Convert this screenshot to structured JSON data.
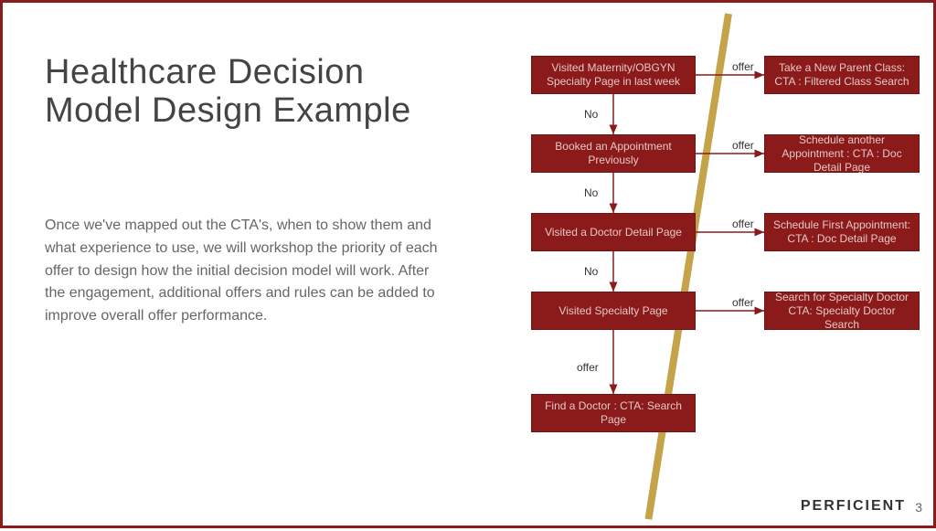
{
  "title_line1": "Healthcare Decision",
  "title_line2": "Model Design Example",
  "body_text": "Once we've mapped out the CTA's, when to show them and what experience to use, we will workshop the priority of each offer to design how the initial decision model will work. After the engagement, additional offers and rules can be added to improve overall offer performance.",
  "brand": "PERFICIENT",
  "page_number": "3",
  "colors": {
    "node_fill": "#8b1a1a",
    "accent": "#c4a349"
  },
  "decision_steps": [
    {
      "label": "Visited Maternity/OBGYN Specialty Page in last week",
      "offer_label": "Take a New Parent Class: CTA : Filtered Class Search"
    },
    {
      "label": "Booked an Appointment Previously",
      "offer_label": "Schedule another Appointment : CTA : Doc Detail Page"
    },
    {
      "label": "Visited a Doctor Detail Page",
      "offer_label": "Schedule First Appointment: CTA : Doc Detail Page"
    },
    {
      "label": "Visited Specialty Page",
      "offer_label": "Search for Specialty Doctor CTA: Specialty Doctor Search"
    }
  ],
  "fallback_offer": "Find a Doctor : CTA: Search Page",
  "edge_labels": {
    "no": "No",
    "offer": "offer"
  }
}
